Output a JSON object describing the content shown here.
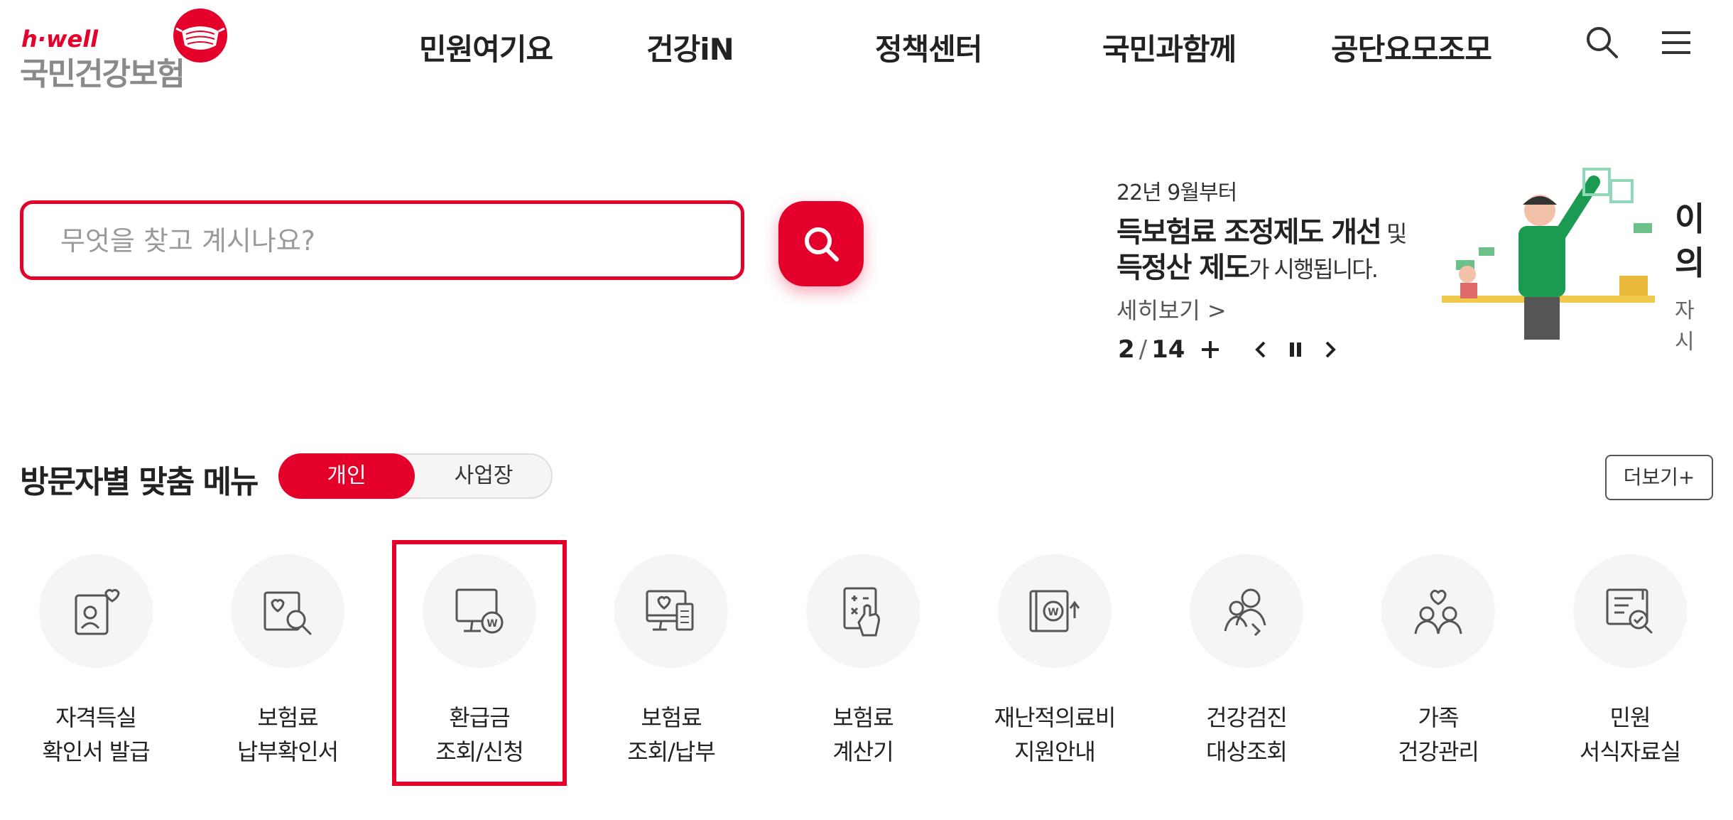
{
  "header": {
    "logo_top": "h·well",
    "logo_main": "국민건강보험",
    "nav": [
      "민원여기요",
      "건강iN",
      "정책센터",
      "국민과함께",
      "공단요모조모"
    ],
    "icons": [
      "search-icon",
      "hamburger-menu-icon"
    ]
  },
  "search": {
    "placeholder": "무엇을 찾고 계시나요?",
    "icon": "search-icon"
  },
  "banner": {
    "date": "22년 9월부터",
    "line1_bold": "득보험료 조정제도 개선",
    "line1_small": " 및",
    "line2_bold": "득정산 제도",
    "line2_normal": "가 시행됩니다.",
    "more": "세히보기 >",
    "right_line1": "이",
    "right_line2": "의",
    "right_line3": "자시",
    "current": "2",
    "total": "14"
  },
  "visitor_menu": {
    "title": "방문자별 맞춤 메뉴",
    "toggle_on": "개인",
    "toggle_off": "사업장",
    "more_button": "더보기+",
    "items": [
      {
        "line1": "자격득실",
        "line2": "확인서 발급",
        "icon": "id-card-heart-icon"
      },
      {
        "line1": "보험료",
        "line2": "납부확인서",
        "icon": "document-search-icon"
      },
      {
        "line1": "환급금",
        "line2": "조회/신청",
        "icon": "monitor-won-icon"
      },
      {
        "line1": "보험료",
        "line2": "조회/납부",
        "icon": "monitor-receipt-icon"
      },
      {
        "line1": "보험료",
        "line2": "계산기",
        "icon": "calculator-hand-icon"
      },
      {
        "line1": "재난적의료비",
        "line2": "지원안내",
        "icon": "book-won-icon"
      },
      {
        "line1": "건강검진",
        "line2": "대상조회",
        "icon": "person-search-icon"
      },
      {
        "line1": "가족",
        "line2": "건강관리",
        "icon": "family-heart-icon"
      },
      {
        "line1": "민원",
        "line2": "서식자료실",
        "icon": "document-check-icon"
      }
    ]
  },
  "colors": {
    "brand_red": "#e4002b",
    "logo_gray": "#8a8a8a",
    "circle_bg": "#f5f5f5",
    "icon_stroke": "#555555"
  }
}
